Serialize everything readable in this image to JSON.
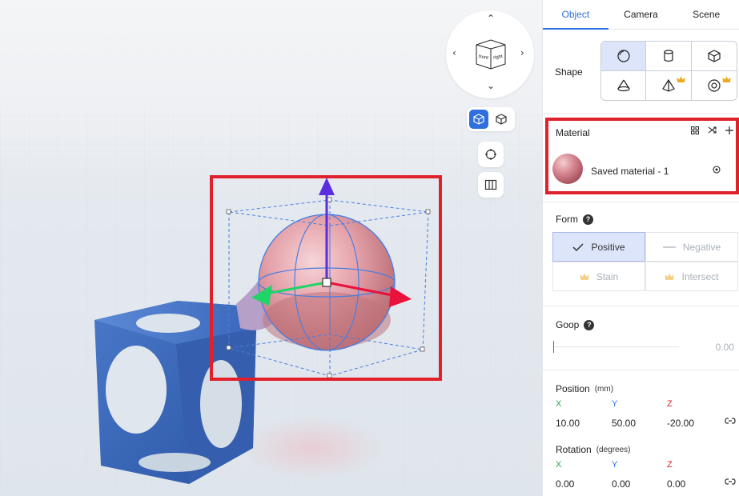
{
  "tabs": [
    "Object",
    "Camera",
    "Scene"
  ],
  "shape": {
    "label": "Shape"
  },
  "material": {
    "title": "Material",
    "name": "Saved material - 1"
  },
  "form": {
    "label": "Form",
    "positive": "Positive",
    "negative": "Negative",
    "stain": "Stain",
    "intersect": "Intersect"
  },
  "goop": {
    "label": "Goop",
    "value": "0.00"
  },
  "position": {
    "label": "Position",
    "unit": "(mm)",
    "x_label": "X",
    "y_label": "Y",
    "z_label": "Z",
    "x": "10.00",
    "y": "50.00",
    "z": "-20.00"
  },
  "rotation": {
    "label": "Rotation",
    "unit": "(degrees)",
    "x_label": "X",
    "y_label": "Y",
    "z_label": "Z",
    "x": "0.00",
    "y": "0.00",
    "z": "0.00"
  },
  "nav_cube": {
    "front": "front",
    "right": "right"
  },
  "colors": {
    "accent": "#2f6fde",
    "highlight": "#e0202a",
    "x_axis": "#2aa44a",
    "y_axis": "#2f6fde",
    "z_axis": "#e0202a",
    "premium": "#f0a81a"
  }
}
